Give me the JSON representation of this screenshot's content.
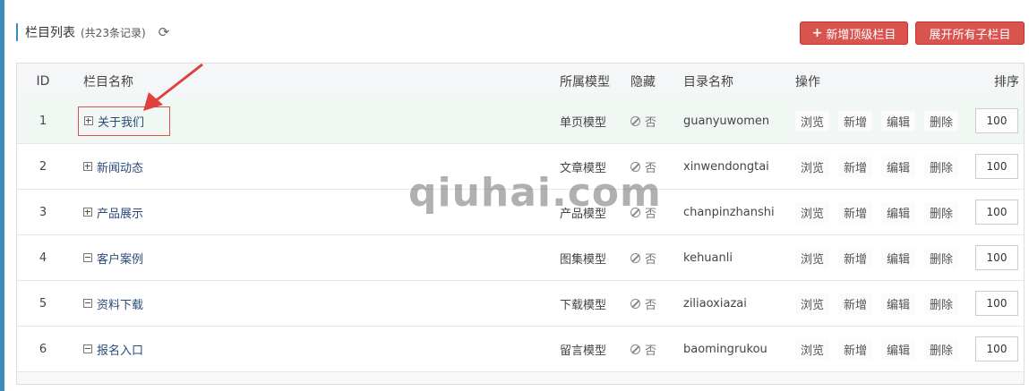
{
  "header": {
    "title": "栏目列表",
    "record_count": "(共23条记录)",
    "refresh_icon": "refresh-icon",
    "add_button_label": "新增顶级栏目",
    "add_button_icon": "plus-icon",
    "expand_button_label": "展开所有子栏目"
  },
  "table": {
    "columns": {
      "id": "ID",
      "name": "栏目名称",
      "model": "所属模型",
      "hidden": "隐藏",
      "dir": "目录名称",
      "ops": "操作",
      "sort": "排序"
    },
    "rows": [
      {
        "id": "1",
        "name": "关于我们",
        "tree": "expand",
        "model": "单页模型",
        "hidden": "否",
        "dir": "guanyuwomen",
        "ops": [
          "浏览",
          "新增",
          "编辑",
          "删除"
        ],
        "sort": "100"
      },
      {
        "id": "2",
        "name": "新闻动态",
        "tree": "expand",
        "model": "文章模型",
        "hidden": "否",
        "dir": "xinwendongtai",
        "ops": [
          "浏览",
          "新增",
          "编辑",
          "删除"
        ],
        "sort": "100"
      },
      {
        "id": "3",
        "name": "产品展示",
        "tree": "expand",
        "model": "产品模型",
        "hidden": "否",
        "dir": "chanpinzhanshi",
        "ops": [
          "浏览",
          "新增",
          "编辑",
          "删除"
        ],
        "sort": "100"
      },
      {
        "id": "4",
        "name": "客户案例",
        "tree": "collapse",
        "model": "图集模型",
        "hidden": "否",
        "dir": "kehuanli",
        "ops": [
          "浏览",
          "新增",
          "编辑",
          "删除"
        ],
        "sort": "100"
      },
      {
        "id": "5",
        "name": "资料下载",
        "tree": "collapse",
        "model": "下载模型",
        "hidden": "否",
        "dir": "ziliaoxiazai",
        "ops": [
          "浏览",
          "新增",
          "编辑",
          "删除"
        ],
        "sort": "100"
      },
      {
        "id": "6",
        "name": "报名入口",
        "tree": "collapse",
        "model": "留言模型",
        "hidden": "否",
        "dir": "baomingrukou",
        "ops": [
          "浏览",
          "新增",
          "编辑",
          "删除"
        ],
        "sort": "100"
      }
    ]
  },
  "watermark": "qiuhai.com",
  "colors": {
    "accent_blue": "#3c8dbc",
    "button_red": "#d9534f",
    "highlight_row": "#f1f8f4",
    "annotation_red": "#e0413c"
  }
}
